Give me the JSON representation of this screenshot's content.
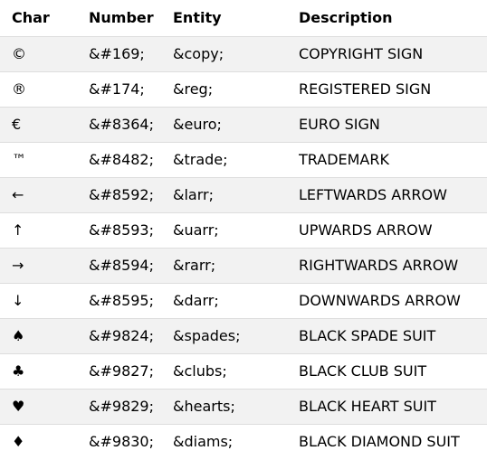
{
  "table": {
    "headers": {
      "char": "Char",
      "number": "Number",
      "entity": "Entity",
      "description": "Description"
    },
    "rows": [
      {
        "char": "©",
        "number": "&#169;",
        "entity": "&copy;",
        "description": "COPYRIGHT SIGN"
      },
      {
        "char": "®",
        "number": "&#174;",
        "entity": "&reg;",
        "description": "REGISTERED SIGN"
      },
      {
        "char": "€",
        "number": "&#8364;",
        "entity": "&euro;",
        "description": "EURO SIGN"
      },
      {
        "char": "™",
        "number": "&#8482;",
        "entity": "&trade;",
        "description": "TRADEMARK"
      },
      {
        "char": "←",
        "number": "&#8592;",
        "entity": "&larr;",
        "description": "LEFTWARDS ARROW"
      },
      {
        "char": "↑",
        "number": "&#8593;",
        "entity": "&uarr;",
        "description": "UPWARDS ARROW"
      },
      {
        "char": "→",
        "number": "&#8594;",
        "entity": "&rarr;",
        "description": "RIGHTWARDS ARROW"
      },
      {
        "char": "↓",
        "number": "&#8595;",
        "entity": "&darr;",
        "description": "DOWNWARDS ARROW"
      },
      {
        "char": "♠",
        "number": "&#9824;",
        "entity": "&spades;",
        "description": "BLACK SPADE SUIT"
      },
      {
        "char": "♣",
        "number": "&#9827;",
        "entity": "&clubs;",
        "description": "BLACK CLUB SUIT"
      },
      {
        "char": "♥",
        "number": "&#9829;",
        "entity": "&hearts;",
        "description": "BLACK HEART SUIT"
      },
      {
        "char": "♦",
        "number": "&#9830;",
        "entity": "&diams;",
        "description": "BLACK DIAMOND SUIT"
      }
    ]
  },
  "colors": {
    "row_stripe": "#f2f2f2",
    "row_plain": "#ffffff",
    "row_border": "#dddddd",
    "text": "#000000"
  }
}
